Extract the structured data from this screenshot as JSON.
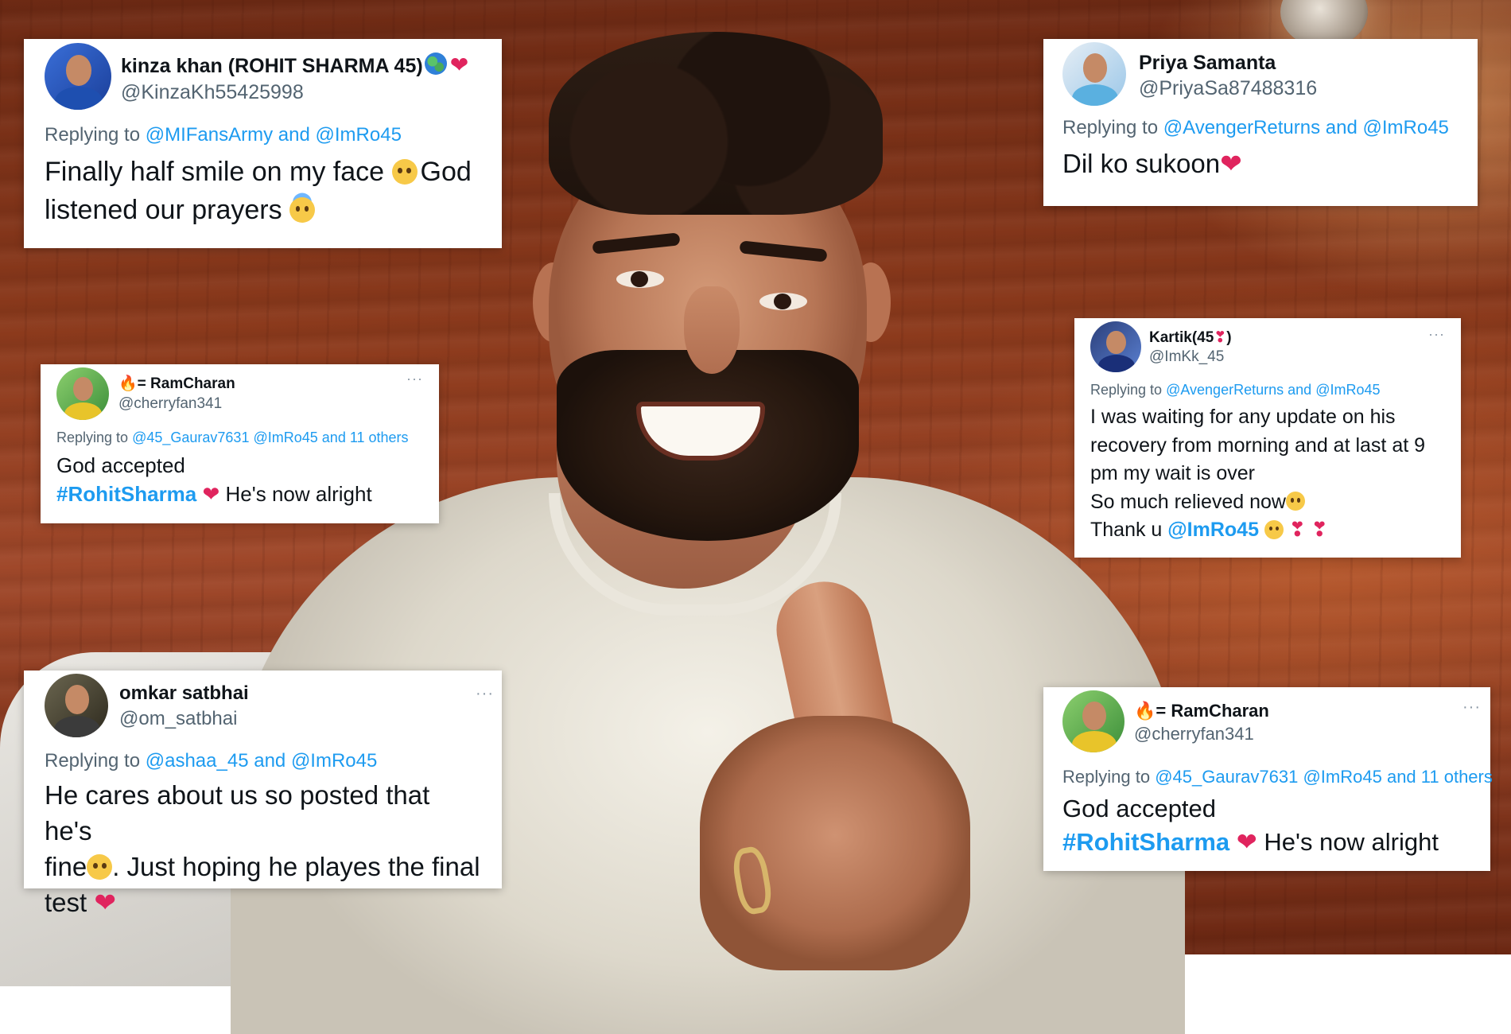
{
  "tweets": [
    {
      "name": "kinza khan (ROHIT SHARMA 45)",
      "name_suffix_icons": [
        "globe-emoji",
        "red-heart-emoji"
      ],
      "handle": "@KinzaKh55425998",
      "replying_prefix": "Replying to",
      "replying_to": [
        "@MIFansArmy",
        "@ImRo45"
      ],
      "replying_joiner": "and",
      "text_parts": [
        "Finally half smile on my face ",
        "God listened our prayers "
      ],
      "text_emojis": [
        "pleading-face-emoji",
        "smiling-face-with-halo-emoji"
      ]
    },
    {
      "name": "Priya Samanta",
      "handle": "@PriyaSa87488316",
      "replying_prefix": "Replying to",
      "replying_to": [
        "@AvengerReturns",
        "@ImRo45"
      ],
      "replying_joiner": "and",
      "text": "Dil ko sukoon",
      "text_emojis": [
        "red-heart-emoji"
      ]
    },
    {
      "name_prefix_icon": "fire-emoji",
      "name": "= RamCharan",
      "handle": "@cherryfan341",
      "replying_prefix": "Replying to",
      "replying_to": [
        "@45_Gaurav7631",
        "@ImRo45"
      ],
      "replying_others": "and 11 others",
      "text_line1": "God accepted",
      "hashtag": "#RohitSharma",
      "text_after": " He's now alright",
      "text_emojis": [
        "red-heart-emoji"
      ]
    },
    {
      "name": "Kartik(45",
      "name_suffix": ")",
      "name_suffix_icons": [
        "red-pin-emoji"
      ],
      "handle": "@ImKk_45",
      "replying_prefix": "Replying to",
      "replying_to": [
        "@AvengerReturns",
        "@ImRo45"
      ],
      "replying_joiner": "and",
      "text_lines": [
        "I was waiting for any update on his",
        "recovery from morning and at last at 9",
        "pm my wait is over",
        "So much relieved now"
      ],
      "thank_prefix": "Thank u ",
      "thank_mention": "@ImRo45",
      "text_emojis": [
        "relieved-face-emoji",
        "pleading-face-emoji",
        "red-pin-emoji",
        "red-pin-emoji"
      ]
    },
    {
      "name": "omkar satbhai",
      "handle": "@om_satbhai",
      "replying_prefix": "Replying to",
      "replying_to": [
        "@ashaa_45",
        "@ImRo45"
      ],
      "replying_joiner": "and",
      "text_lines": [
        "He cares about us so posted that he's",
        "fine",
        ". Just hoping he playes the final",
        "test "
      ],
      "text_emojis": [
        "pleading-face-emoji",
        "red-heart-emoji"
      ]
    },
    {
      "name_prefix_icon": "fire-emoji",
      "name": "= RamCharan",
      "handle": "@cherryfan341",
      "replying_prefix": "Replying to",
      "replying_to": [
        "@45_Gaurav7631",
        "@ImRo45"
      ],
      "replying_others": "and 11 others",
      "text_line1": "God accepted",
      "hashtag": "#RohitSharma",
      "text_after": " He's now alright",
      "text_emojis": [
        "red-heart-emoji"
      ]
    }
  ],
  "more_label": "···",
  "colors": {
    "link": "#1d9bf0",
    "handle": "#536471",
    "text": "#0f1419",
    "heart": "#e0245e",
    "card": "#ffffff"
  }
}
